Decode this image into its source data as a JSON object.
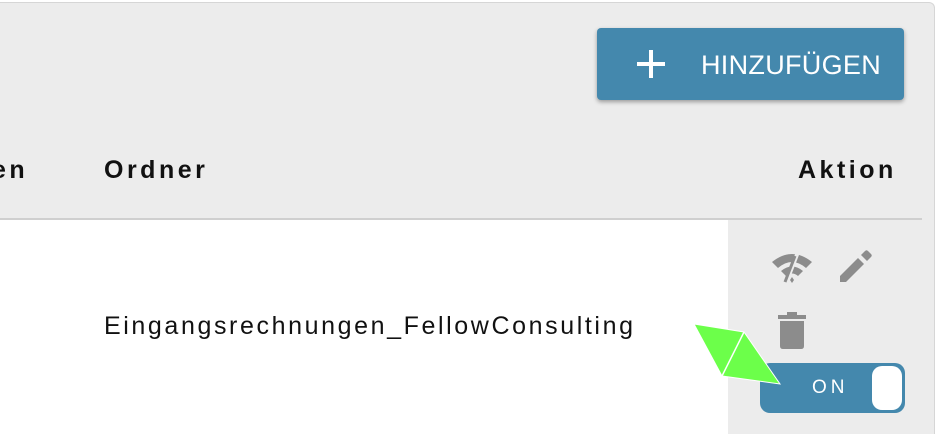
{
  "toolbar": {
    "add_label": "HINZUFÜGEN",
    "add_icon": "plus-icon"
  },
  "table": {
    "columns": [
      {
        "label": "en"
      },
      {
        "label": "Ordner"
      },
      {
        "label": "Aktion"
      }
    ],
    "rows": [
      {
        "folder": "Eingangsrechnungen_FellowConsulting",
        "actions": {
          "icons": [
            "wifi-off-icon",
            "edit-icon",
            "delete-icon"
          ],
          "toggle_label": "ON"
        }
      }
    ]
  },
  "colors": {
    "accent": "#4488ad",
    "panel_bg": "#ececec",
    "icon_gray": "#8c8c8c",
    "cursor": "#6cff4a"
  }
}
